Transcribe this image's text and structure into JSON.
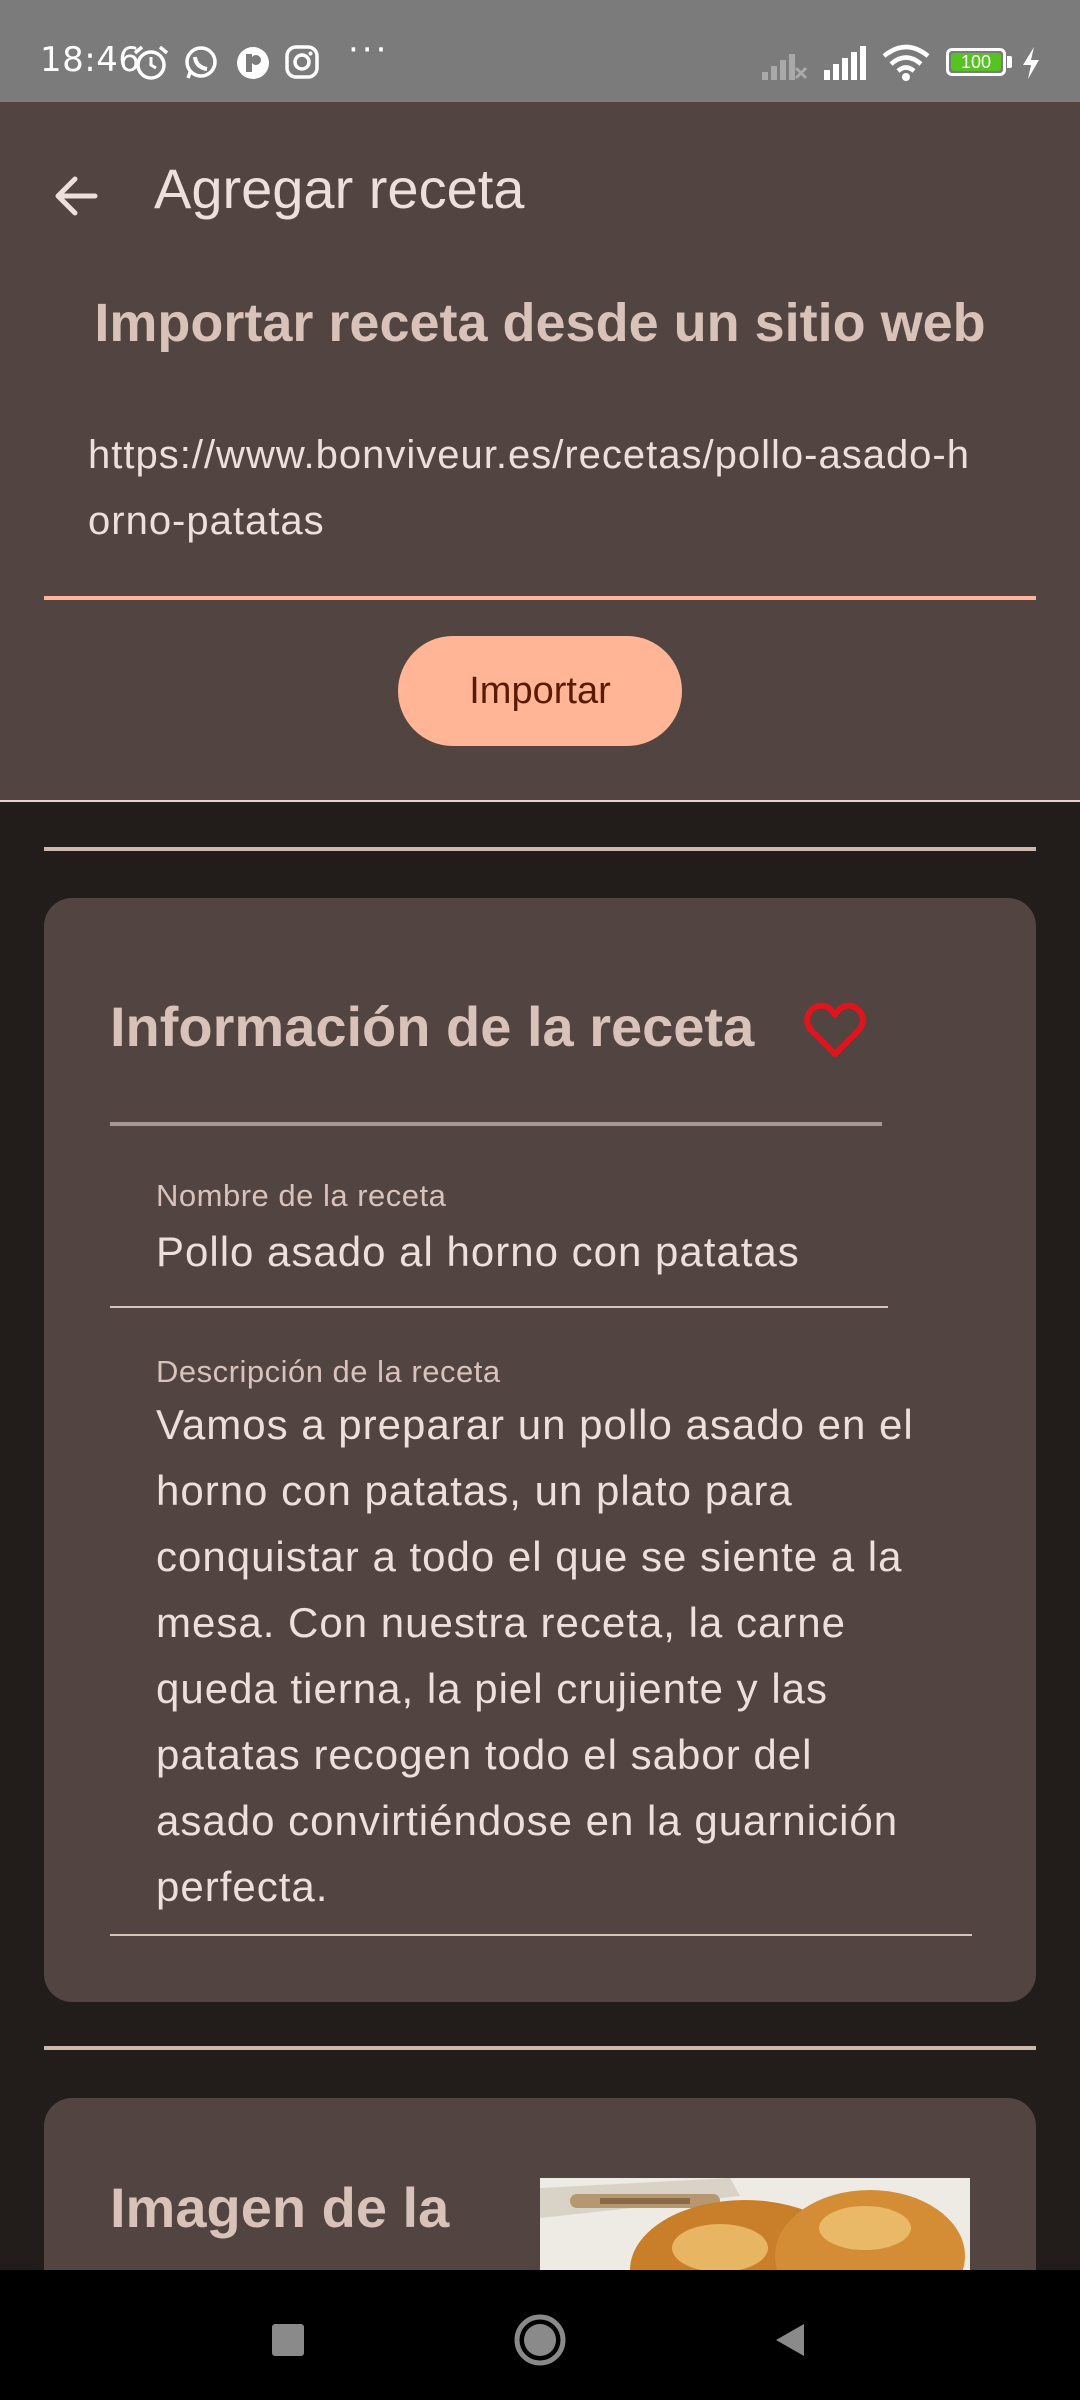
{
  "status_bar": {
    "time": "18:46",
    "icons": [
      "alarm-icon",
      "whatsapp-icon",
      "app-icon",
      "instagram-icon"
    ],
    "more": "···",
    "battery_level": "100",
    "battery_color": "#55c322"
  },
  "app_bar": {
    "title": "Agregar receta"
  },
  "import": {
    "title": "Importar receta desde un sitio web",
    "url_value": "https://www.bonviveur.es/recetas/pollo-asado-horno-patatas",
    "button_label": "Importar",
    "accent_color": "#ffb596"
  },
  "recipe_info": {
    "title": "Información de la receta",
    "favorite": false,
    "name_label": "Nombre de la receta",
    "name_value": "Pollo asado al horno con patatas",
    "description_label": "Descripción de la receta",
    "description_value": "Vamos a preparar un pollo asado en el horno con patatas, un plato para conquistar a todo el que se siente a la mesa. Con nuestra receta, la carne queda tierna, la piel crujiente y las patatas recogen todo el sabor del asado convirtiéndose en la guarnición perfecta."
  },
  "recipe_image": {
    "title": "Imagen de la receta"
  },
  "colors": {
    "surface": "#514441",
    "background": "#221c1a",
    "heart": "#e0141c"
  }
}
